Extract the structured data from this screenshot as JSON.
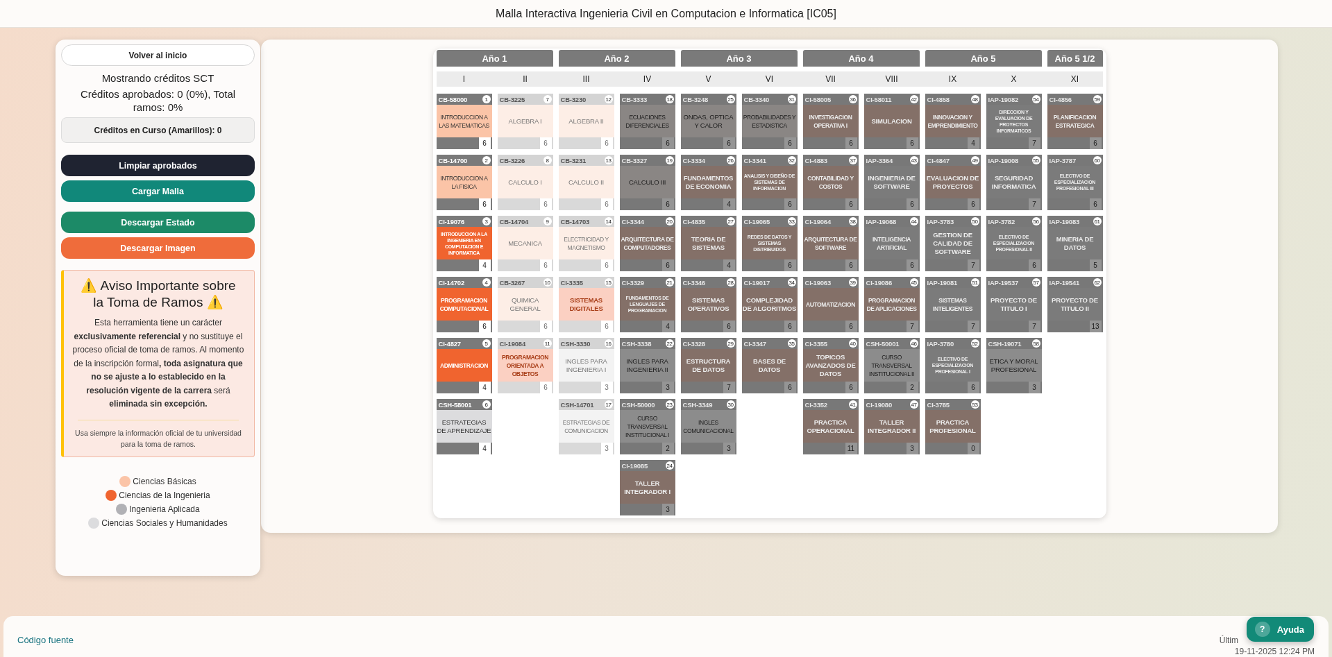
{
  "header": {
    "title": "Malla Interactiva Ingenieria Civil en Computacion e Informatica [IC05]"
  },
  "sidebar": {
    "back_button": "Volver al inicio",
    "credits_mode": "Mostrando créditos SCT",
    "approved_summary": "Créditos aprobados: 0 (0%), Total ramos: 0%",
    "in_progress": "Créditos en Curso (Amarillos): 0",
    "buttons": [
      {
        "label": "Limpiar aprobados",
        "kind": "dark"
      },
      {
        "label": "Cargar Malla",
        "kind": "teal"
      },
      {
        "label": "Descargar Estado",
        "kind": "green"
      },
      {
        "label": "Descargar Imagen",
        "kind": "orange"
      }
    ],
    "notice": {
      "title": "⚠️ Aviso Importante sobre la Toma de Ramos ⚠️",
      "body": "Esta herramienta tiene un carácter **exclusivamente referencial** y no sustituye el proceso oficial de toma de ramos. Al momento de la inscripción formal**, toda asignatura que no se ajuste a lo establecido en la resolución vigente de la carrera** será **eliminada sin excepción.**",
      "footnote": "Usa siempre la información oficial de tu universidad para la toma de ramos."
    },
    "legend": [
      {
        "label": "Ciencias Básicas",
        "kind": "basicas",
        "color": "#fbc4a7"
      },
      {
        "label": "Ciencias de la Ingenieria",
        "kind": "ingenieria",
        "color": "#f0642f"
      },
      {
        "label": "Ingenieria Aplicada",
        "kind": "aplicada",
        "color": "#b1b1b5"
      },
      {
        "label": "Ciencias Sociales y Humanidades",
        "kind": "sociales",
        "color": "#dcdcde"
      }
    ]
  },
  "malla": {
    "years": [
      {
        "label": "Año 1",
        "semesters": [
          {
            "numeral": "I",
            "courses": [
              {
                "code": "CB-58000",
                "number": "1",
                "name": "INTRODUCCION A LAS MATEMATICAS",
                "credits": "6",
                "kind": "basicas",
                "locked": false,
                "dimmed": false
              },
              {
                "code": "CB-14700",
                "number": "2",
                "name": "INTRODUCCION A LA FISICA",
                "credits": "6",
                "kind": "basicas",
                "locked": false,
                "dimmed": false
              },
              {
                "code": "CI-19076",
                "number": "3",
                "name": "INTRODUCCION A LA INGENIERIA EN COMPUTACION E INFORMATICA",
                "credits": "4",
                "kind": "ingenieria",
                "locked": false,
                "dimmed": false
              },
              {
                "code": "CI-14702",
                "number": "4",
                "name": "PROGRAMACION COMPUTACIONAL",
                "credits": "6",
                "kind": "ingenieria",
                "locked": false,
                "dimmed": false
              },
              {
                "code": "CI-4827",
                "number": "5",
                "name": "ADMINISTRACION",
                "credits": "4",
                "kind": "ingenieria",
                "locked": false,
                "dimmed": false
              },
              {
                "code": "CSH-58001",
                "number": "6",
                "name": "ESTRATEGIAS DE APRENDIZAJE",
                "credits": "4",
                "kind": "sociales",
                "locked": false,
                "dimmed": false
              }
            ]
          },
          {
            "numeral": "II",
            "courses": [
              {
                "code": "CB-3225",
                "number": "7",
                "name": "ALGEBRA I",
                "credits": "6",
                "kind": "basicas",
                "locked": true,
                "dimmed": false
              },
              {
                "code": "CB-3226",
                "number": "8",
                "name": "CALCULO I",
                "credits": "6",
                "kind": "basicas",
                "locked": true,
                "dimmed": false
              },
              {
                "code": "CB-14704",
                "number": "9",
                "name": "MECANICA",
                "credits": "6",
                "kind": "basicas",
                "locked": true,
                "dimmed": false
              },
              {
                "code": "CB-3267",
                "number": "10",
                "name": "QUIMICA GENERAL",
                "credits": "6",
                "kind": "basicas",
                "locked": true,
                "dimmed": false
              },
              {
                "code": "CI-19084",
                "number": "11",
                "name": "PROGRAMACION ORIENTADA A OBJETOS",
                "credits": "6",
                "kind": "ingenieria",
                "locked": true,
                "dimmed": false
              }
            ]
          }
        ]
      },
      {
        "label": "Año 2",
        "semesters": [
          {
            "numeral": "III",
            "courses": [
              {
                "code": "CB-3230",
                "number": "12",
                "name": "ALGEBRA II",
                "credits": "6",
                "kind": "basicas",
                "locked": true,
                "dimmed": false
              },
              {
                "code": "CB-3231",
                "number": "13",
                "name": "CALCULO II",
                "credits": "6",
                "kind": "basicas",
                "locked": true,
                "dimmed": false
              },
              {
                "code": "CB-14703",
                "number": "14",
                "name": "ELECTRICIDAD Y MAGNETISMO",
                "credits": "6",
                "kind": "basicas",
                "locked": true,
                "dimmed": false
              },
              {
                "code": "CI-3335",
                "number": "15",
                "name": "SISTEMAS DIGITALES",
                "credits": "6",
                "kind": "ingenieria",
                "locked": true,
                "dimmed": false
              },
              {
                "code": "CSH-3330",
                "number": "16",
                "name": "INGLES PARA INGENIERIA I",
                "credits": "3",
                "kind": "sociales",
                "locked": true,
                "dimmed": false
              },
              {
                "code": "CSH-14701",
                "number": "17",
                "name": "ESTRATEGIAS DE COMUNICACION",
                "credits": "3",
                "kind": "sociales",
                "locked": true,
                "dimmed": false
              }
            ]
          },
          {
            "numeral": "IV",
            "courses": [
              {
                "code": "CB-3333",
                "number": "18",
                "name": "ECUACIONES DIFERENCIALES",
                "credits": "6",
                "kind": "basicas",
                "locked": true,
                "dimmed": true
              },
              {
                "code": "CB-3327",
                "number": "19",
                "name": "CALCULO III",
                "credits": "6",
                "kind": "basicas",
                "locked": true,
                "dimmed": true
              },
              {
                "code": "CI-3344",
                "number": "20",
                "name": "ARQUITECTURA DE COMPUTADORES",
                "credits": "6",
                "kind": "ingenieria",
                "locked": true,
                "dimmed": true
              },
              {
                "code": "CI-3329",
                "number": "21",
                "name": "FUNDAMENTOS DE LENGUAJES DE PROGRAMACION",
                "credits": "4",
                "kind": "ingenieria",
                "locked": true,
                "dimmed": true
              },
              {
                "code": "CSH-3338",
                "number": "22",
                "name": "INGLES PARA INGENIERIA II",
                "credits": "3",
                "kind": "sociales",
                "locked": true,
                "dimmed": true
              },
              {
                "code": "CSH-50000",
                "number": "23",
                "name": "CURSO TRANSVERSAL INSTITUCIONAL I",
                "credits": "2",
                "kind": "sociales",
                "locked": true,
                "dimmed": true
              },
              {
                "code": "CI-19085",
                "number": "24",
                "name": "TALLER INTEGRADOR I",
                "credits": "3",
                "kind": "ingenieria",
                "locked": true,
                "dimmed": true
              }
            ]
          }
        ]
      },
      {
        "label": "Año 3",
        "semesters": [
          {
            "numeral": "V",
            "courses": [
              {
                "code": "CB-3248",
                "number": "25",
                "name": "ONDAS, OPTICA Y CALOR",
                "credits": "6",
                "kind": "basicas",
                "locked": true,
                "dimmed": true
              },
              {
                "code": "CI-3334",
                "number": "26",
                "name": "FUNDAMENTOS DE ECONOMIA",
                "credits": "4",
                "kind": "ingenieria",
                "locked": true,
                "dimmed": true
              },
              {
                "code": "CI-4835",
                "number": "27",
                "name": "TEORIA DE SISTEMAS",
                "credits": "4",
                "kind": "ingenieria",
                "locked": true,
                "dimmed": true
              },
              {
                "code": "CI-3346",
                "number": "28",
                "name": "SISTEMAS OPERATIVOS",
                "credits": "6",
                "kind": "ingenieria",
                "locked": true,
                "dimmed": true
              },
              {
                "code": "CI-3328",
                "number": "29",
                "name": "ESTRUCTURA DE DATOS",
                "credits": "7",
                "kind": "ingenieria",
                "locked": true,
                "dimmed": true
              },
              {
                "code": "CSH-3349",
                "number": "30",
                "name": "INGLES COMUNICACIONAL",
                "credits": "3",
                "kind": "sociales",
                "locked": true,
                "dimmed": true
              }
            ]
          },
          {
            "numeral": "VI",
            "courses": [
              {
                "code": "CB-3340",
                "number": "31",
                "name": "PROBABILIDADES Y ESTADISTICA",
                "credits": "6",
                "kind": "basicas",
                "locked": true,
                "dimmed": true
              },
              {
                "code": "CI-3341",
                "number": "32",
                "name": "ANALISIS Y DISEÑO DE SISTEMAS DE INFORMACION",
                "credits": "6",
                "kind": "ingenieria",
                "locked": true,
                "dimmed": true
              },
              {
                "code": "CI-19065",
                "number": "33",
                "name": "REDES DE DATOS Y SISTEMAS DISTRIBUIDOS",
                "credits": "6",
                "kind": "ingenieria",
                "locked": true,
                "dimmed": true
              },
              {
                "code": "CI-19017",
                "number": "34",
                "name": "COMPLEJIDAD DE ALGORITMOS",
                "credits": "6",
                "kind": "ingenieria",
                "locked": true,
                "dimmed": true
              },
              {
                "code": "CI-3347",
                "number": "35",
                "name": "BASES DE DATOS",
                "credits": "6",
                "kind": "ingenieria",
                "locked": true,
                "dimmed": true
              }
            ]
          }
        ]
      },
      {
        "label": "Año 4",
        "semesters": [
          {
            "numeral": "VII",
            "courses": [
              {
                "code": "CI-58005",
                "number": "36",
                "name": "INVESTIGACION OPERATIVA I",
                "credits": "6",
                "kind": "ingenieria",
                "locked": true,
                "dimmed": true
              },
              {
                "code": "CI-4883",
                "number": "37",
                "name": "CONTABILIDAD Y COSTOS",
                "credits": "6",
                "kind": "ingenieria",
                "locked": true,
                "dimmed": true
              },
              {
                "code": "CI-19064",
                "number": "38",
                "name": "ARQUITECTURA DE SOFTWARE",
                "credits": "6",
                "kind": "ingenieria",
                "locked": true,
                "dimmed": true
              },
              {
                "code": "CI-19063",
                "number": "39",
                "name": "AUTOMATIZACION",
                "credits": "6",
                "kind": "ingenieria",
                "locked": true,
                "dimmed": true
              },
              {
                "code": "CI-3355",
                "number": "40",
                "name": "TOPICOS AVANZADOS DE DATOS",
                "credits": "6",
                "kind": "ingenieria",
                "locked": true,
                "dimmed": true
              },
              {
                "code": "CI-3352",
                "number": "41",
                "name": "PRACTICA OPERACIONAL",
                "credits": "11",
                "kind": "ingenieria",
                "locked": true,
                "dimmed": true
              }
            ]
          },
          {
            "numeral": "VIII",
            "courses": [
              {
                "code": "CI-58011",
                "number": "42",
                "name": "SIMULACION",
                "credits": "6",
                "kind": "ingenieria",
                "locked": true,
                "dimmed": true
              },
              {
                "code": "IAP-3364",
                "number": "43",
                "name": "INGENIERIA DE SOFTWARE",
                "credits": "6",
                "kind": "aplicada",
                "locked": true,
                "dimmed": true
              },
              {
                "code": "IAP-19068",
                "number": "44",
                "name": "INTELIGENCIA ARTIFICIAL",
                "credits": "6",
                "kind": "aplicada",
                "locked": true,
                "dimmed": true
              },
              {
                "code": "CI-19086",
                "number": "45",
                "name": "PROGRAMACION DE APLICACIONES",
                "credits": "7",
                "kind": "ingenieria",
                "locked": true,
                "dimmed": true
              },
              {
                "code": "CSH-50001",
                "number": "46",
                "name": "CURSO TRANSVERSAL INSTITUCIONAL II",
                "credits": "2",
                "kind": "sociales",
                "locked": true,
                "dimmed": true
              },
              {
                "code": "CI-19080",
                "number": "47",
                "name": "TALLER INTEGRADOR II",
                "credits": "3",
                "kind": "ingenieria",
                "locked": true,
                "dimmed": true
              }
            ]
          }
        ]
      },
      {
        "label": "Año 5",
        "semesters": [
          {
            "numeral": "IX",
            "courses": [
              {
                "code": "CI-4858",
                "number": "48",
                "name": "INNOVACION Y EMPRENDIMIENTO",
                "credits": "4",
                "kind": "ingenieria",
                "locked": true,
                "dimmed": true
              },
              {
                "code": "CI-4847",
                "number": "49",
                "name": "EVALUACION DE PROYECTOS",
                "credits": "6",
                "kind": "ingenieria",
                "locked": true,
                "dimmed": true
              },
              {
                "code": "IAP-3783",
                "number": "50",
                "name": "GESTION DE CALIDAD DE SOFTWARE",
                "credits": "7",
                "kind": "aplicada",
                "locked": true,
                "dimmed": true
              },
              {
                "code": "IAP-19081",
                "number": "51",
                "name": "SISTEMAS INTELIGENTES",
                "credits": "7",
                "kind": "aplicada",
                "locked": true,
                "dimmed": true
              },
              {
                "code": "IAP-3780",
                "number": "52",
                "name": "ELECTIVO DE ESPECIALIZACION PROFESIONAL I",
                "credits": "6",
                "kind": "aplicada",
                "locked": true,
                "dimmed": true
              },
              {
                "code": "CI-3785",
                "number": "53",
                "name": "PRACTICA PROFESIONAL",
                "credits": "0",
                "kind": "ingenieria",
                "locked": true,
                "dimmed": true
              }
            ]
          },
          {
            "numeral": "X",
            "courses": [
              {
                "code": "IAP-19082",
                "number": "54",
                "name": "DIRECCION Y EVALUACION DE PROYECTOS INFORMATICOS",
                "credits": "7",
                "kind": "aplicada",
                "locked": true,
                "dimmed": true
              },
              {
                "code": "IAP-19008",
                "number": "55",
                "name": "SEGURIDAD INFORMATICA",
                "credits": "7",
                "kind": "aplicada",
                "locked": true,
                "dimmed": true
              },
              {
                "code": "IAP-3782",
                "number": "56",
                "name": "ELECTIVO DE ESPECIALIZACION PROFESIONAL II",
                "credits": "6",
                "kind": "aplicada",
                "locked": true,
                "dimmed": true
              },
              {
                "code": "IAP-19537",
                "number": "57",
                "name": "PROYECTO DE TITULO I",
                "credits": "7",
                "kind": "aplicada",
                "locked": true,
                "dimmed": true
              },
              {
                "code": "CSH-19071",
                "number": "58",
                "name": "ETICA Y MORAL PROFESIONAL",
                "credits": "3",
                "kind": "sociales",
                "locked": true,
                "dimmed": true
              }
            ]
          }
        ]
      },
      {
        "label": "Año 5 1/2",
        "semesters": [
          {
            "numeral": "XI",
            "courses": [
              {
                "code": "CI-4856",
                "number": "59",
                "name": "PLANIFICACION ESTRATEGICA",
                "credits": "6",
                "kind": "ingenieria",
                "locked": true,
                "dimmed": true
              },
              {
                "code": "IAP-3787",
                "number": "60",
                "name": "ELECTIVO DE ESPECIALIZACION PROFESIONAL III",
                "credits": "6",
                "kind": "aplicada",
                "locked": true,
                "dimmed": true
              },
              {
                "code": "IAP-19083",
                "number": "61",
                "name": "MINERIA DE DATOS",
                "credits": "5",
                "kind": "aplicada",
                "locked": true,
                "dimmed": true
              },
              {
                "code": "IAP-19541",
                "number": "62",
                "name": "PROYECTO DE TITULO II",
                "credits": "13",
                "kind": "aplicada",
                "locked": true,
                "dimmed": true
              }
            ]
          }
        ]
      }
    ]
  },
  "footer": {
    "source_link": "Código fuente",
    "updated_label": "Últim",
    "updated_date": "19-11-2025 12:24 PM",
    "help_button": "Ayuda",
    "help_icon": "?"
  }
}
